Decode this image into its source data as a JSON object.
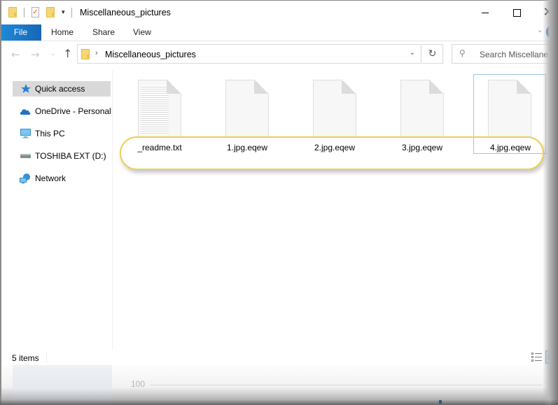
{
  "window": {
    "title": "Miscellaneous_pictures",
    "controls": {
      "minimize": "minimize",
      "maximize": "maximize",
      "close": "✕"
    }
  },
  "quick_access_toolbar": {
    "icons": [
      "folder-icon",
      "properties-icon",
      "new-folder-icon",
      "customize-dropdown-icon"
    ],
    "dropdown_glyph": "▾"
  },
  "ribbon": {
    "tabs": [
      {
        "label": "File",
        "active": true
      },
      {
        "label": "Home"
      },
      {
        "label": "Share"
      },
      {
        "label": "View"
      }
    ],
    "expand_glyph": "⌄",
    "help_glyph": "?"
  },
  "navigation": {
    "back_glyph": "←",
    "forward_glyph": "→",
    "recent_glyph": "⌄",
    "up_glyph": "↑",
    "address": {
      "separator": "›",
      "path": [
        "Miscellaneous_pictures"
      ],
      "dropdown_glyph": "⌄"
    },
    "refresh_glyph": "↻",
    "search": {
      "placeholder": "Search Miscellane...",
      "icon_glyph": "⚲"
    }
  },
  "sidebar": {
    "items": [
      {
        "label": "Quick access",
        "icon": "star-icon",
        "selected": true
      },
      {
        "label": "OneDrive - Personal",
        "icon": "cloud-icon"
      },
      {
        "label": "This PC",
        "icon": "monitor-icon"
      },
      {
        "label": "TOSHIBA EXT (D:)",
        "icon": "drive-icon"
      },
      {
        "label": "Network",
        "icon": "network-icon"
      }
    ]
  },
  "files": [
    {
      "name": "_readme.txt",
      "type": "text"
    },
    {
      "name": "1.jpg.eqew",
      "type": "unknown"
    },
    {
      "name": "2.jpg.eqew",
      "type": "unknown"
    },
    {
      "name": "3.jpg.eqew",
      "type": "unknown"
    },
    {
      "name": "4.jpg.eqew",
      "type": "unknown",
      "focused": true
    }
  ],
  "status": {
    "item_count": "5 items",
    "views": [
      "details-view",
      "large-icons-view"
    ],
    "active_view": "large-icons-view"
  },
  "background": {
    "axis_tick_label": "100"
  },
  "colors": {
    "accent": "#1979ca",
    "highlight_annotation": "#f2cd58",
    "selection": "#d9d9d9",
    "focus_border": "#99c9e6"
  }
}
